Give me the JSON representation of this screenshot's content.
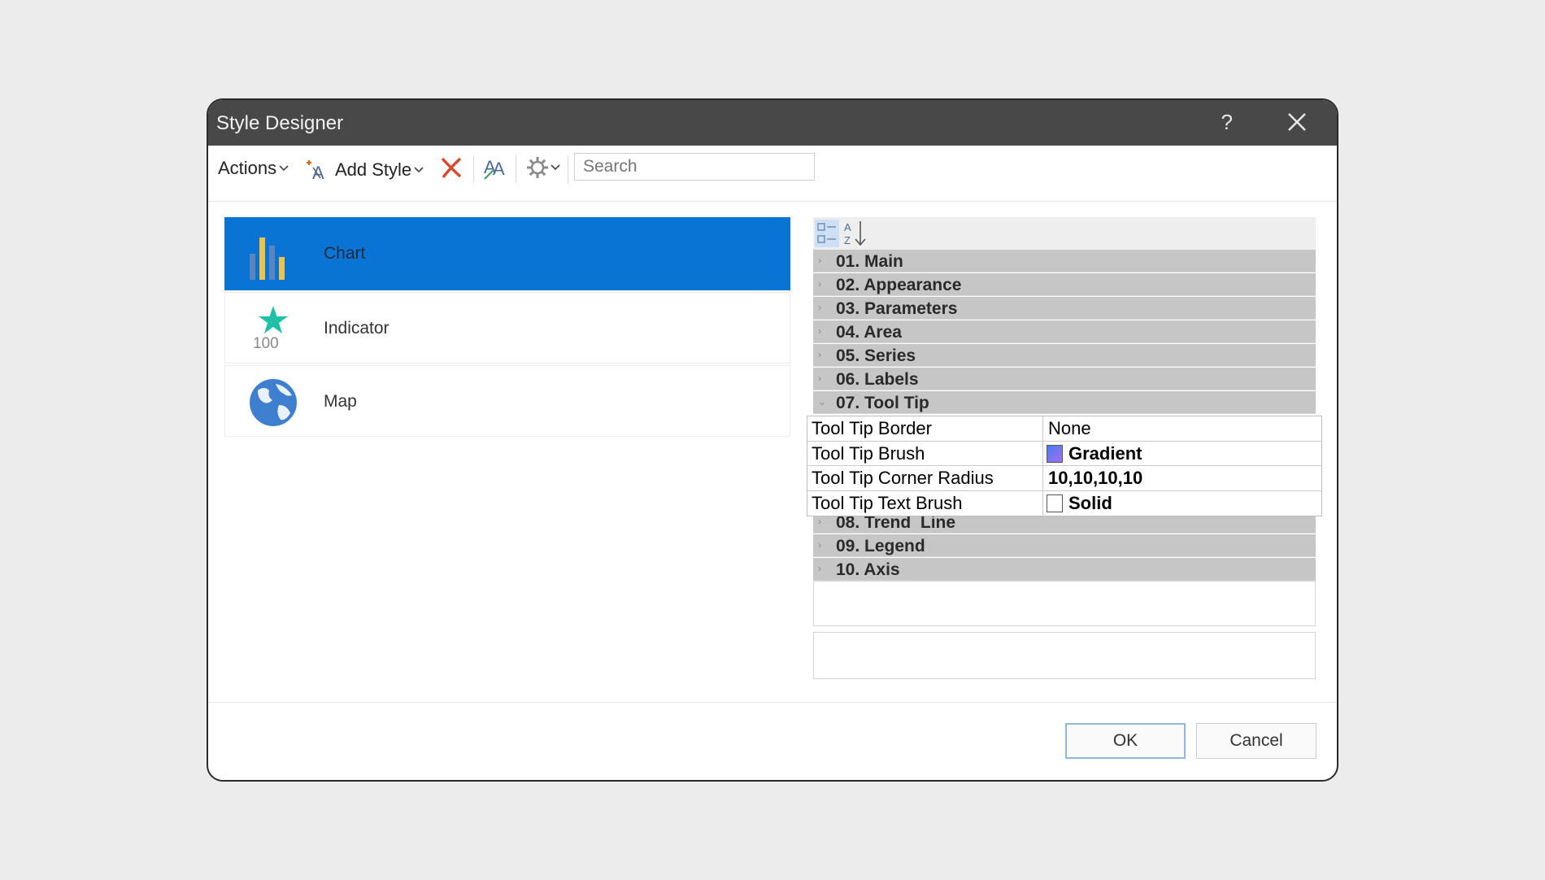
{
  "window": {
    "title": "Style Designer",
    "help_label": "?"
  },
  "toolbar": {
    "actions_label": "Actions",
    "add_style_label": "Add Style",
    "search_placeholder": "Search"
  },
  "styles": [
    {
      "label": "Chart",
      "icon": "bar-chart-icon",
      "selected": true
    },
    {
      "label": "Indicator",
      "icon": "star-indicator-icon",
      "value": "100"
    },
    {
      "label": "Map",
      "icon": "globe-icon"
    }
  ],
  "property_grid": {
    "categories_before": [
      "01. Main",
      "02. Appearance",
      "03. Parameters",
      "04. Area",
      "05. Series",
      "06. Labels"
    ],
    "expanded_category": "07. Tool Tip",
    "properties": [
      {
        "name": "Tool Tip Border",
        "value": "None"
      },
      {
        "name": "Tool Tip Brush",
        "value": "Gradient",
        "swatch": "#6d6df0"
      },
      {
        "name": "Tool Tip Corner Radius",
        "value": "10,10,10,10"
      },
      {
        "name": "Tool Tip Text Brush",
        "value": "Solid",
        "swatch": "#ffffff"
      }
    ],
    "categories_after": [
      "08. Trend  Line",
      "09. Legend",
      "10. Axis"
    ]
  },
  "footer": {
    "ok_label": "OK",
    "cancel_label": "Cancel"
  },
  "colors": {
    "selection": "#0a74d4",
    "titlebar": "#484848",
    "category_band": "#c6c6c6"
  }
}
